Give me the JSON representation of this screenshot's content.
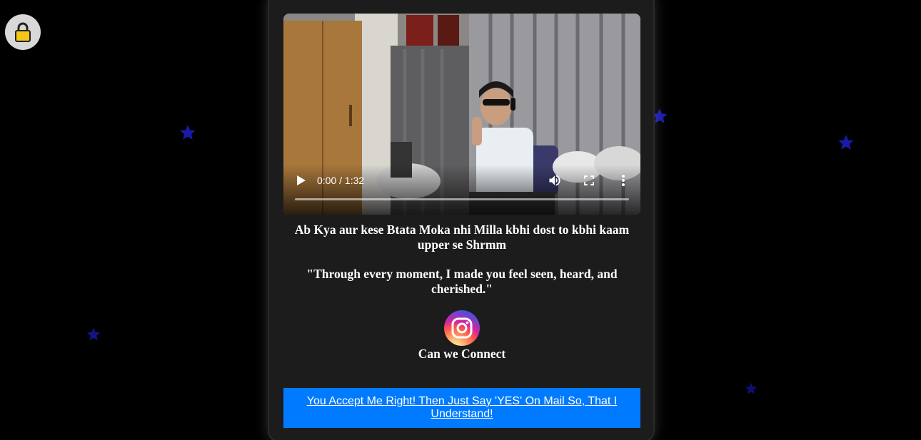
{
  "icons": {
    "lock": "lock-icon",
    "play": "play-icon",
    "volume": "volume-icon",
    "fullscreen": "fullscreen-icon",
    "more": "more-options-icon",
    "instagram": "instagram-icon",
    "star": "star-icon"
  },
  "colors": {
    "background": "#000000",
    "card": "#1c1c1c",
    "star": "#1a1aa8",
    "button": "#007bff"
  },
  "video": {
    "time": "0:00 / 1:32",
    "progress": 0
  },
  "message": {
    "line": "Ab Kya aur kese Btata Moka nhi Milla kbhi dost to kbhi kaam upper se Shrmm",
    "quote": "\"Through every moment, I made you feel seen, heard, and cherished.\""
  },
  "social": {
    "connect_label": "Can we Connect"
  },
  "cta": {
    "label": "You Accept Me Right! Then Just Say 'YES' On Mail So, That I Understand!"
  }
}
